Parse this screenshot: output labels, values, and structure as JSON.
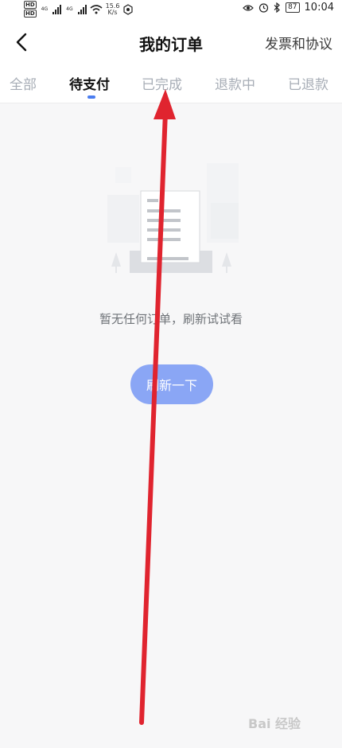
{
  "status_bar": {
    "network_tag": "4G",
    "speed_value": "15.6",
    "speed_unit": "K/s",
    "battery": "87",
    "time": "10:04"
  },
  "header": {
    "title": "我的订单",
    "right_link": "发票和协议"
  },
  "tabs": [
    {
      "label": "全部"
    },
    {
      "label": "待支付"
    },
    {
      "label": "已完成"
    },
    {
      "label": "退款中"
    },
    {
      "label": "已退款"
    }
  ],
  "active_tab_index": 1,
  "empty_state": {
    "message": "暂无任何订单，刷新试试看",
    "button_label": "刷新一下"
  },
  "watermark": "Bai 经验"
}
